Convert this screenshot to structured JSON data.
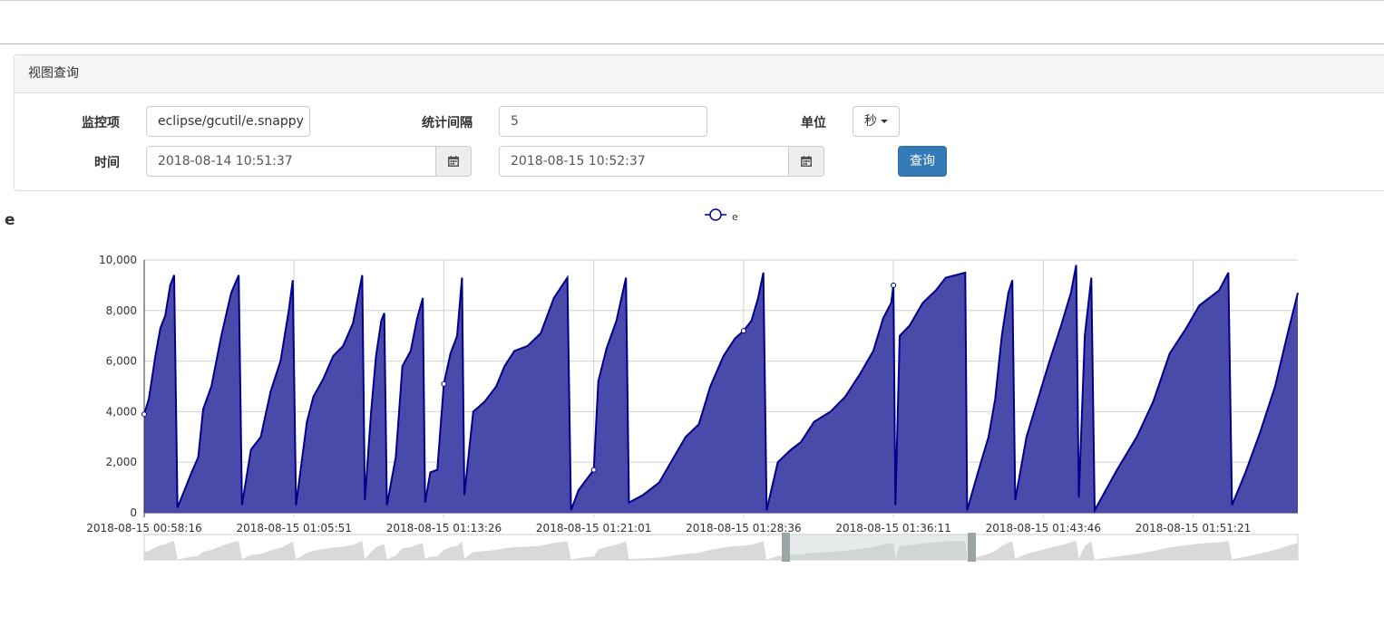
{
  "panel": {
    "heading": "视图查询"
  },
  "form": {
    "monitor_label": "监控项",
    "monitor_value": "eclipse/gcutil/e.snappy",
    "interval_label": "统计间隔",
    "interval_value": "5",
    "unit_label": "单位",
    "unit_value": "秒",
    "time_label": "时间",
    "time_start": "2018-08-14 10:51:37",
    "time_end": "2018-08-15 10:52:37",
    "query_button": "查询"
  },
  "colors": {
    "series_line": "#00008b",
    "series_fill": "#4a4aab",
    "grid": "#d0d0d0",
    "navigator_fill": "#d9d9d9",
    "navigator_handle": "#9aa5a5"
  },
  "chart_data": {
    "type": "area",
    "title": "e",
    "legend": {
      "entries": [
        "e"
      ],
      "position": "top-center"
    },
    "grid": true,
    "ylim": [
      0,
      10000
    ],
    "y_ticks": [
      "0",
      "2,000",
      "4,000",
      "6,000",
      "8,000",
      "10,000"
    ],
    "x_ticks": [
      "2018-08-15 00:58:16",
      "2018-08-15 01:05:51",
      "2018-08-15 01:13:26",
      "2018-08-15 01:21:01",
      "2018-08-15 01:28:36",
      "2018-08-15 01:36:11",
      "2018-08-15 01:43:46",
      "2018-08-15 01:51:21"
    ],
    "series": [
      {
        "name": "e",
        "points": [
          [
            "2018-08-15 00:58:16",
            3900
          ],
          [
            "2018-08-15 00:58:30",
            4500
          ],
          [
            "2018-08-15 00:58:50",
            6200
          ],
          [
            "2018-08-15 00:59:05",
            7300
          ],
          [
            "2018-08-15 00:59:20",
            7800
          ],
          [
            "2018-08-15 00:59:35",
            9000
          ],
          [
            "2018-08-15 00:59:47",
            9400
          ],
          [
            "2018-08-15 00:59:57",
            200
          ],
          [
            "2018-08-15 01:00:40",
            1600
          ],
          [
            "2018-08-15 01:01:00",
            2200
          ],
          [
            "2018-08-15 01:01:15",
            4100
          ],
          [
            "2018-08-15 01:01:40",
            5000
          ],
          [
            "2018-08-15 01:02:10",
            7000
          ],
          [
            "2018-08-15 01:02:40",
            8700
          ],
          [
            "2018-08-15 01:03:03",
            9400
          ],
          [
            "2018-08-15 01:03:13",
            300
          ],
          [
            "2018-08-15 01:03:40",
            2500
          ],
          [
            "2018-08-15 01:04:10",
            3000
          ],
          [
            "2018-08-15 01:04:40",
            4800
          ],
          [
            "2018-08-15 01:05:10",
            6000
          ],
          [
            "2018-08-15 01:05:35",
            8000
          ],
          [
            "2018-08-15 01:05:47",
            9200
          ],
          [
            "2018-08-15 01:05:57",
            300
          ],
          [
            "2018-08-15 01:06:10",
            1600
          ],
          [
            "2018-08-15 01:06:30",
            3600
          ],
          [
            "2018-08-15 01:06:50",
            4600
          ],
          [
            "2018-08-15 01:07:20",
            5300
          ],
          [
            "2018-08-15 01:07:50",
            6200
          ],
          [
            "2018-08-15 01:08:20",
            6600
          ],
          [
            "2018-08-15 01:08:50",
            7500
          ],
          [
            "2018-08-15 01:09:18",
            9400
          ],
          [
            "2018-08-15 01:09:26",
            500
          ],
          [
            "2018-08-15 01:09:45",
            4000
          ],
          [
            "2018-08-15 01:10:00",
            6200
          ],
          [
            "2018-08-15 01:10:16",
            7600
          ],
          [
            "2018-08-15 01:10:25",
            7900
          ],
          [
            "2018-08-15 01:10:33",
            300
          ],
          [
            "2018-08-15 01:11:00",
            2200
          ],
          [
            "2018-08-15 01:11:20",
            5800
          ],
          [
            "2018-08-15 01:11:45",
            6400
          ],
          [
            "2018-08-15 01:12:05",
            7700
          ],
          [
            "2018-08-15 01:12:22",
            8500
          ],
          [
            "2018-08-15 01:12:29",
            400
          ],
          [
            "2018-08-15 01:12:45",
            1600
          ],
          [
            "2018-08-15 01:13:06",
            1700
          ],
          [
            "2018-08-15 01:13:26",
            5100
          ],
          [
            "2018-08-15 01:13:46",
            6300
          ],
          [
            "2018-08-15 01:14:06",
            7000
          ],
          [
            "2018-08-15 01:14:21",
            9300
          ],
          [
            "2018-08-15 01:14:28",
            700
          ],
          [
            "2018-08-15 01:14:55",
            4000
          ],
          [
            "2018-08-15 01:15:30",
            4400
          ],
          [
            "2018-08-15 01:16:05",
            5000
          ],
          [
            "2018-08-15 01:16:30",
            5800
          ],
          [
            "2018-08-15 01:17:00",
            6400
          ],
          [
            "2018-08-15 01:17:40",
            6600
          ],
          [
            "2018-08-15 01:18:20",
            7100
          ],
          [
            "2018-08-15 01:19:00",
            8500
          ],
          [
            "2018-08-15 01:19:41",
            9300
          ],
          [
            "2018-08-15 01:19:52",
            100
          ],
          [
            "2018-08-15 01:20:15",
            900
          ],
          [
            "2018-08-15 01:21:01",
            1700
          ],
          [
            "2018-08-15 01:21:15",
            5200
          ],
          [
            "2018-08-15 01:21:40",
            6500
          ],
          [
            "2018-08-15 01:22:10",
            7600
          ],
          [
            "2018-08-15 01:22:39",
            9300
          ],
          [
            "2018-08-15 01:22:48",
            400
          ],
          [
            "2018-08-15 01:23:30",
            700
          ],
          [
            "2018-08-15 01:24:20",
            1200
          ],
          [
            "2018-08-15 01:25:00",
            2100
          ],
          [
            "2018-08-15 01:25:40",
            3000
          ],
          [
            "2018-08-15 01:26:20",
            3500
          ],
          [
            "2018-08-15 01:26:55",
            5000
          ],
          [
            "2018-08-15 01:27:35",
            6200
          ],
          [
            "2018-08-15 01:28:10",
            6900
          ],
          [
            "2018-08-15 01:28:36",
            7200
          ],
          [
            "2018-08-15 01:29:00",
            7600
          ],
          [
            "2018-08-15 01:29:20",
            8500
          ],
          [
            "2018-08-15 01:29:36",
            9500
          ],
          [
            "2018-08-15 01:29:46",
            100
          ],
          [
            "2018-08-15 01:30:20",
            2000
          ],
          [
            "2018-08-15 01:31:00",
            2500
          ],
          [
            "2018-08-15 01:31:30",
            2800
          ],
          [
            "2018-08-15 01:32:10",
            3600
          ],
          [
            "2018-08-15 01:33:00",
            4000
          ],
          [
            "2018-08-15 01:33:45",
            4600
          ],
          [
            "2018-08-15 01:34:30",
            5500
          ],
          [
            "2018-08-15 01:35:10",
            6400
          ],
          [
            "2018-08-15 01:35:40",
            7700
          ],
          [
            "2018-08-15 01:36:04",
            8300
          ],
          [
            "2018-08-15 01:36:11",
            9000
          ],
          [
            "2018-08-15 01:36:17",
            300
          ],
          [
            "2018-08-15 01:36:30",
            7000
          ],
          [
            "2018-08-15 01:37:00",
            7400
          ],
          [
            "2018-08-15 01:37:40",
            8300
          ],
          [
            "2018-08-15 01:38:20",
            8800
          ],
          [
            "2018-08-15 01:38:50",
            9300
          ],
          [
            "2018-08-15 01:39:49",
            9500
          ],
          [
            "2018-08-15 01:39:55",
            100
          ],
          [
            "2018-08-15 01:40:30",
            1700
          ],
          [
            "2018-08-15 01:41:00",
            3000
          ],
          [
            "2018-08-15 01:41:20",
            4500
          ],
          [
            "2018-08-15 01:41:40",
            7000
          ],
          [
            "2018-08-15 01:42:00",
            8700
          ],
          [
            "2018-08-15 01:42:12",
            9200
          ],
          [
            "2018-08-15 01:42:21",
            500
          ],
          [
            "2018-08-15 01:42:55",
            3000
          ],
          [
            "2018-08-15 01:43:30",
            4500
          ],
          [
            "2018-08-15 01:44:05",
            6000
          ],
          [
            "2018-08-15 01:44:40",
            7400
          ],
          [
            "2018-08-15 01:45:10",
            8700
          ],
          [
            "2018-08-15 01:45:26",
            9800
          ],
          [
            "2018-08-15 01:45:34",
            600
          ],
          [
            "2018-08-15 01:45:52",
            7000
          ],
          [
            "2018-08-15 01:46:12",
            9300
          ],
          [
            "2018-08-15 01:46:22",
            100
          ],
          [
            "2018-08-15 01:47:30",
            1700
          ],
          [
            "2018-08-15 01:48:30",
            3000
          ],
          [
            "2018-08-15 01:49:20",
            4400
          ],
          [
            "2018-08-15 01:50:10",
            6300
          ],
          [
            "2018-08-15 01:51:00",
            7300
          ],
          [
            "2018-08-15 01:51:40",
            8200
          ],
          [
            "2018-08-15 01:52:40",
            8800
          ],
          [
            "2018-08-15 01:53:08",
            9500
          ],
          [
            "2018-08-15 01:53:19",
            300
          ],
          [
            "2018-08-15 01:54:00",
            1600
          ],
          [
            "2018-08-15 01:54:45",
            3200
          ],
          [
            "2018-08-15 01:55:30",
            5000
          ],
          [
            "2018-08-15 01:56:10",
            7200
          ],
          [
            "2018-08-15 01:56:39",
            8700
          ]
        ]
      }
    ]
  }
}
